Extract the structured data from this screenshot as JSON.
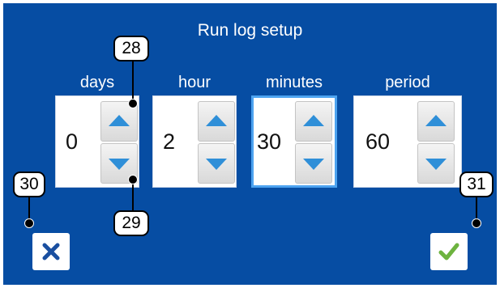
{
  "title": "Run log setup",
  "colors": {
    "background": "#064da3",
    "arrow": "#2f8fd8",
    "confirm": "#6db33f",
    "cancel": "#1a4fa0",
    "focus": "#4da3f0"
  },
  "fields": [
    {
      "label": "days",
      "value": "0"
    },
    {
      "label": "hour",
      "value": "2"
    },
    {
      "label": "minutes",
      "value": "30"
    },
    {
      "label": "period",
      "value": "60"
    }
  ],
  "focused_field": "minutes",
  "buttons": {
    "cancel_icon": "x-icon",
    "confirm_icon": "check-icon"
  },
  "callouts": [
    "28",
    "29",
    "30",
    "31"
  ]
}
